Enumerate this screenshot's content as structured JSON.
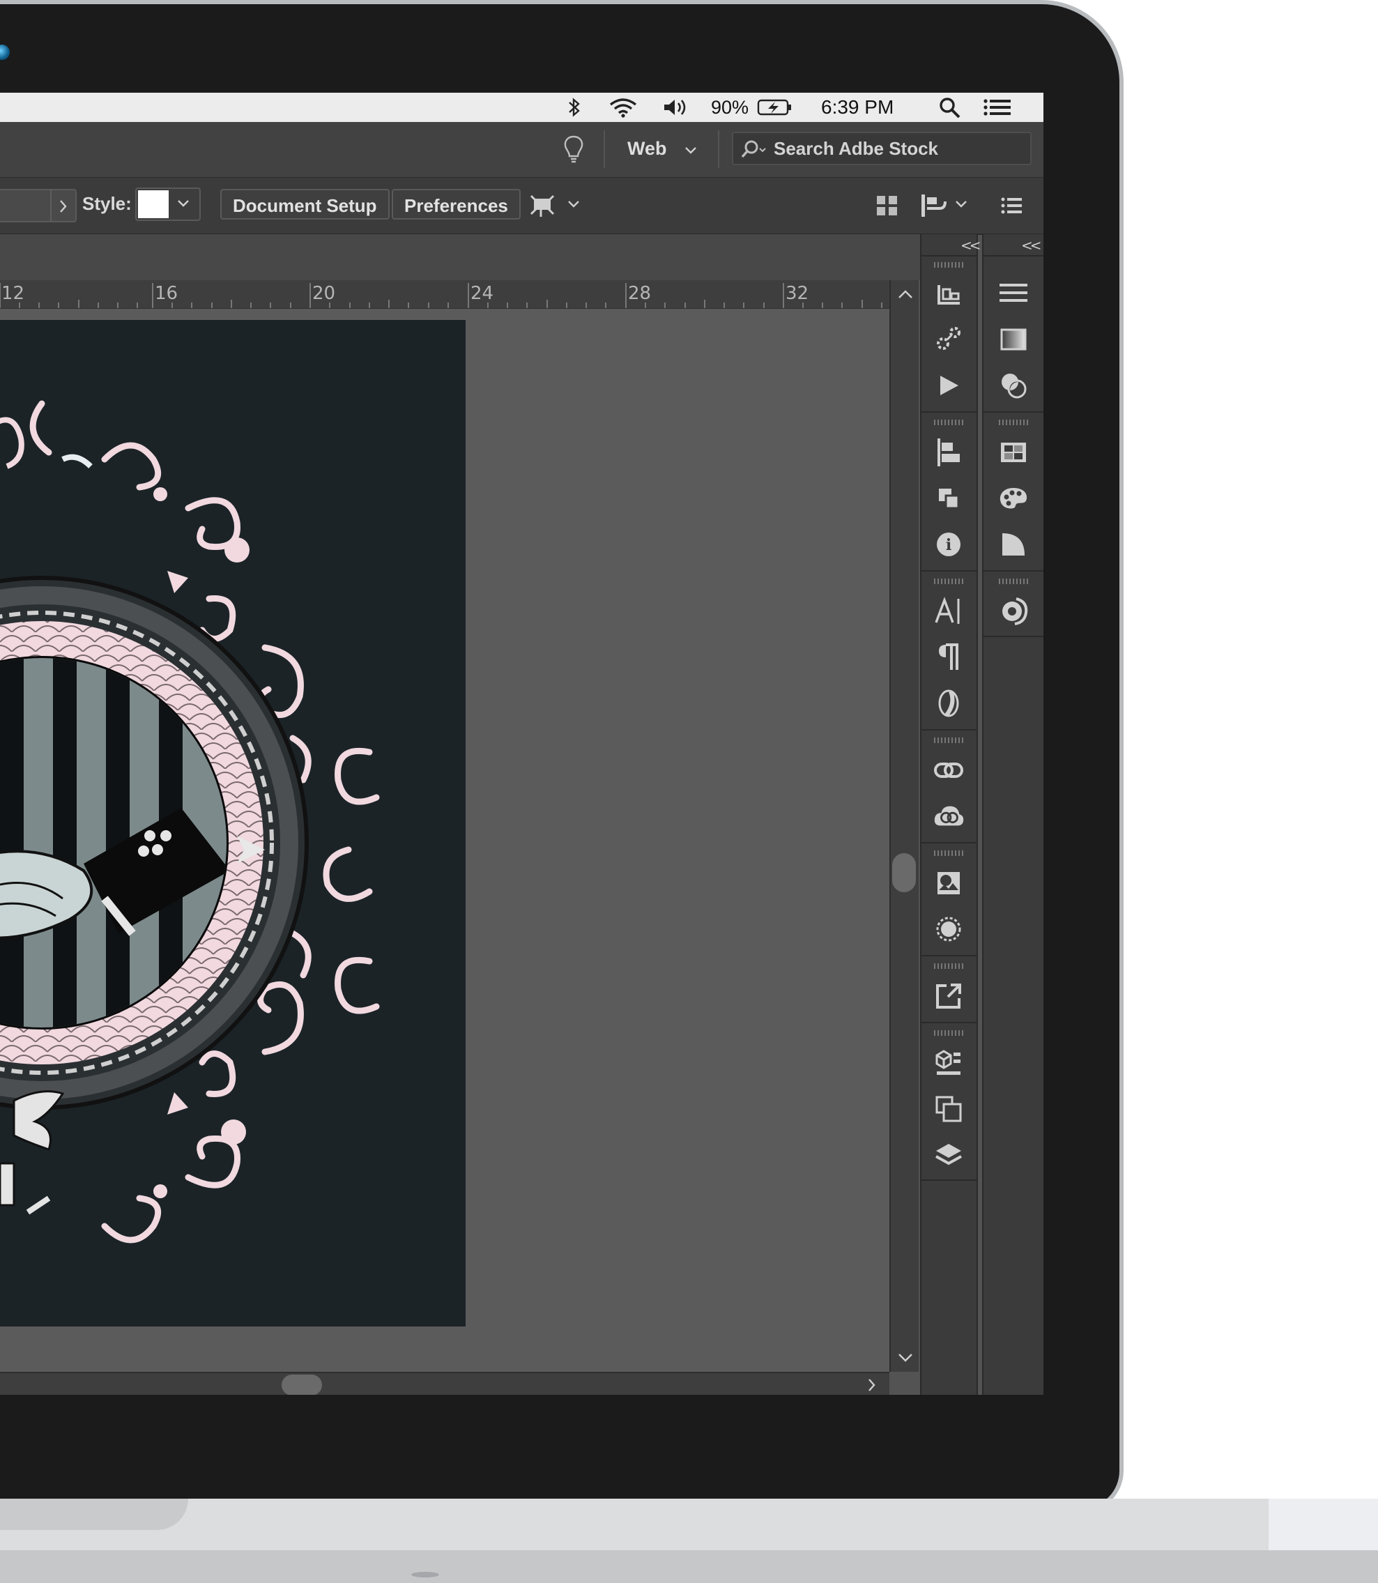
{
  "menubar": {
    "battery": "90%",
    "time": "6:39 PM"
  },
  "app_bar": {
    "workspace": "Web",
    "search_placeholder": "Search Adbe Stock"
  },
  "control_bar": {
    "style_label": "Style:",
    "document_setup": "Document Setup",
    "preferences": "Preferences"
  },
  "ruler": {
    "labels": [
      "12",
      "16",
      "20",
      "24",
      "28",
      "32"
    ]
  },
  "panels": {
    "collapse_glyph": "<<",
    "column1_icons": [
      "artboards-icon",
      "symbols-icon",
      "actions-icon",
      "align-icon",
      "pathfinder-icon",
      "info-icon",
      "character-icon",
      "paragraph-icon",
      "opentype-icon",
      "links-icon",
      "cc-libraries-icon",
      "image-trace-icon",
      "appearance-icon",
      "export-icon",
      "asset-export-icon",
      "artboards-panel-icon",
      "layers-icon"
    ],
    "column2_icons": [
      "stroke-icon",
      "gradient-icon",
      "transparency-icon",
      "swatches-icon",
      "color-guide-icon",
      "graphic-styles-icon",
      "brushes-icon"
    ]
  },
  "colors": {
    "artboard": "#1b2327",
    "ornament": "#f1d9df",
    "accent_pink": "#f3c9d4"
  }
}
